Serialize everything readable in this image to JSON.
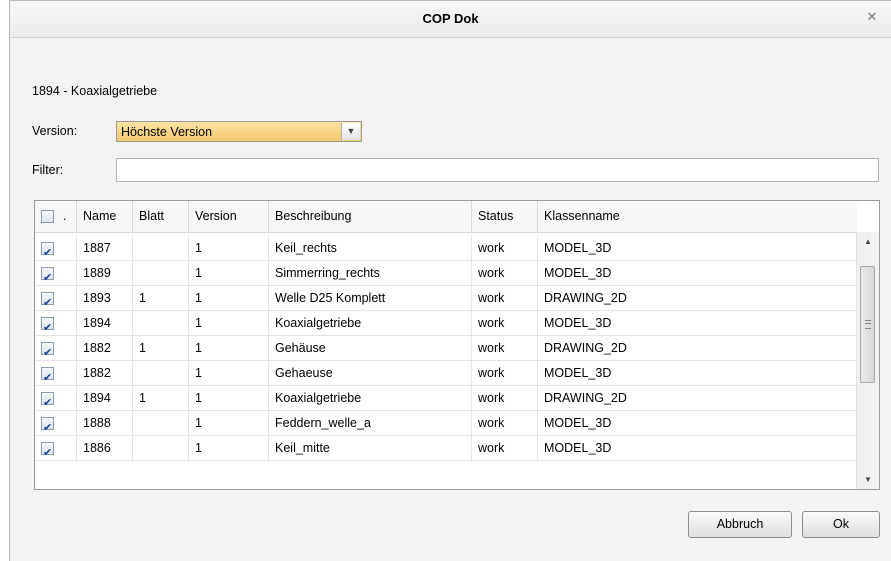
{
  "window": {
    "title": "COP Dok"
  },
  "document_title": "1894 - Koaxialgetriebe",
  "version": {
    "label": "Version:",
    "selected": "Höchste Version"
  },
  "filter": {
    "label": "Filter:",
    "value": ""
  },
  "table": {
    "columns": [
      ".",
      "Name",
      "Blatt",
      "Version",
      "Beschreibung",
      "Status",
      "Klassenname"
    ],
    "rows": [
      {
        "checked": true,
        "name": "1887",
        "blatt": "",
        "version": "1",
        "beschreibung": "Keil_rechts",
        "status": "work",
        "klassenname": "MODEL_3D"
      },
      {
        "checked": true,
        "name": "1889",
        "blatt": "",
        "version": "1",
        "beschreibung": "Simmerring_rechts",
        "status": "work",
        "klassenname": "MODEL_3D"
      },
      {
        "checked": true,
        "name": "1893",
        "blatt": "1",
        "version": "1",
        "beschreibung": "Welle D25 Komplett",
        "status": "work",
        "klassenname": "DRAWING_2D"
      },
      {
        "checked": true,
        "name": "1894",
        "blatt": "",
        "version": "1",
        "beschreibung": "Koaxialgetriebe",
        "status": "work",
        "klassenname": "MODEL_3D"
      },
      {
        "checked": true,
        "name": "1882",
        "blatt": "1",
        "version": "1",
        "beschreibung": "Gehäuse",
        "status": "work",
        "klassenname": "DRAWING_2D"
      },
      {
        "checked": true,
        "name": "1882",
        "blatt": "",
        "version": "1",
        "beschreibung": "Gehaeuse",
        "status": "work",
        "klassenname": "MODEL_3D"
      },
      {
        "checked": true,
        "name": "1894",
        "blatt": "1",
        "version": "1",
        "beschreibung": "Koaxialgetriebe",
        "status": "work",
        "klassenname": "DRAWING_2D"
      },
      {
        "checked": true,
        "name": "1888",
        "blatt": "",
        "version": "1",
        "beschreibung": "Feddern_welle_a",
        "status": "work",
        "klassenname": "MODEL_3D"
      },
      {
        "checked": true,
        "name": "1886",
        "blatt": "",
        "version": "1",
        "beschreibung": "Keil_mitte",
        "status": "work",
        "klassenname": "MODEL_3D"
      }
    ]
  },
  "buttons": {
    "cancel": "Abbruch",
    "ok": "Ok"
  }
}
